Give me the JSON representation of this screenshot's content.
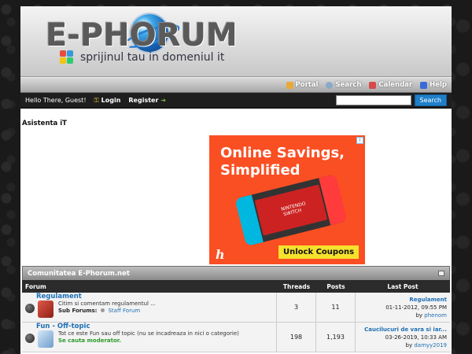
{
  "header": {
    "logo_text": "E-PHORUM",
    "tagline": "sprijinul tau in domeniul it"
  },
  "navbar": {
    "items": [
      {
        "label": "Portal",
        "icon": "portal-icon",
        "color": "#e8a83a"
      },
      {
        "label": "Search",
        "icon": "search-icon",
        "color": "#8aa8c8"
      },
      {
        "label": "Calendar",
        "icon": "calendar-icon",
        "color": "#d84a4a"
      },
      {
        "label": "Help",
        "icon": "help-icon",
        "color": "#3a6ad8"
      }
    ]
  },
  "userbar": {
    "greeting": "Hello There, Guest!",
    "login_label": "Login",
    "register_label": "Register",
    "search_button": "Search",
    "search_value": ""
  },
  "page": {
    "section_title": "Asistenta iT"
  },
  "ad": {
    "line1": "Online Savings,",
    "line2": "Simplified",
    "device_label": "NINTENDO SWITCH",
    "coupon_label": "Unlock Coupons",
    "brand_letter": "h",
    "info": "i",
    "background": "#fa4f23"
  },
  "forum_category": {
    "title": "Comunitatea E-Phorum.net",
    "columns": {
      "forum": "Forum",
      "threads": "Threads",
      "posts": "Posts",
      "last_post": "Last Post"
    },
    "rows": [
      {
        "title": "Regulament",
        "description": "Citim si comentam regulamentul ...",
        "subforums_label": "Sub Forums:",
        "subforum": "Staff Forum",
        "threads": "3",
        "posts": "11",
        "last_title": "Regulament",
        "last_date": "01-11-2012, 09:55 PM",
        "last_by": "by",
        "last_user": "phenom",
        "icon": "book-icon",
        "icon_color": "#c0392b"
      },
      {
        "title": "Fun - Off-topic",
        "description": "Tot ce este Fun sau off topic (nu se incadreaza in nici o categorie)",
        "moderator": "Se cauta moderator.",
        "threads": "198",
        "posts": "1,193",
        "last_title": "Caucilucuri de vara si iar...",
        "last_date": "03-26-2019, 10:33 AM",
        "last_by": "by",
        "last_user": "damyy2019",
        "icon": "fun-book-icon",
        "icon_color": "#7aa8d8"
      }
    ]
  }
}
